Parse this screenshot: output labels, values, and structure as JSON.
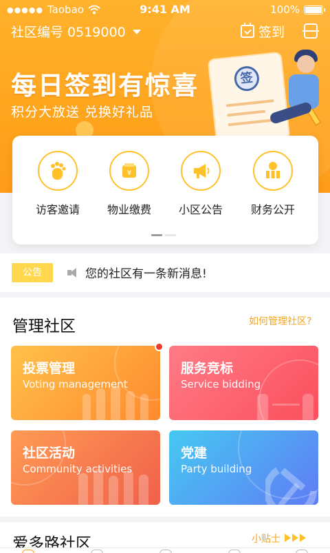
{
  "status_bar": {
    "carrier": "Taobao",
    "time": "9:41 AM",
    "battery": "100%"
  },
  "nav": {
    "community_label": "社区编号 0519000",
    "checkin_label": "签到"
  },
  "banner": {
    "title": "每日签到有惊喜",
    "subtitle": "积分大放送 兑换好礼品",
    "seal_char": "签"
  },
  "quick_menu": {
    "items": [
      {
        "label": "访客邀请",
        "icon": "footprint-icon"
      },
      {
        "label": "物业缴费",
        "icon": "wallet-icon"
      },
      {
        "label": "小区公告",
        "icon": "megaphone-icon"
      },
      {
        "label": "财务公开",
        "icon": "coins-icon"
      }
    ],
    "page_indicator": {
      "current": 1,
      "total": 2
    }
  },
  "notice": {
    "tag": "公告",
    "text": "您的社区有一条新消息!"
  },
  "manage": {
    "title": "管理社区",
    "link": "如何管理社区?",
    "tiles": [
      {
        "cn": "投票管理",
        "en": "Voting management"
      },
      {
        "cn": "服务竞标",
        "en": "Service bidding"
      },
      {
        "cn": "社区活动",
        "en": "Community activities"
      },
      {
        "cn": "党建",
        "en": "Party building"
      }
    ]
  },
  "next_section": {
    "title": "爱多路社区",
    "link": "小贴士"
  },
  "colors": {
    "accent": "#ffa41d",
    "notice_tag": "#ffd84d",
    "link": "#f3a41d",
    "badge": "#f03a2c"
  }
}
